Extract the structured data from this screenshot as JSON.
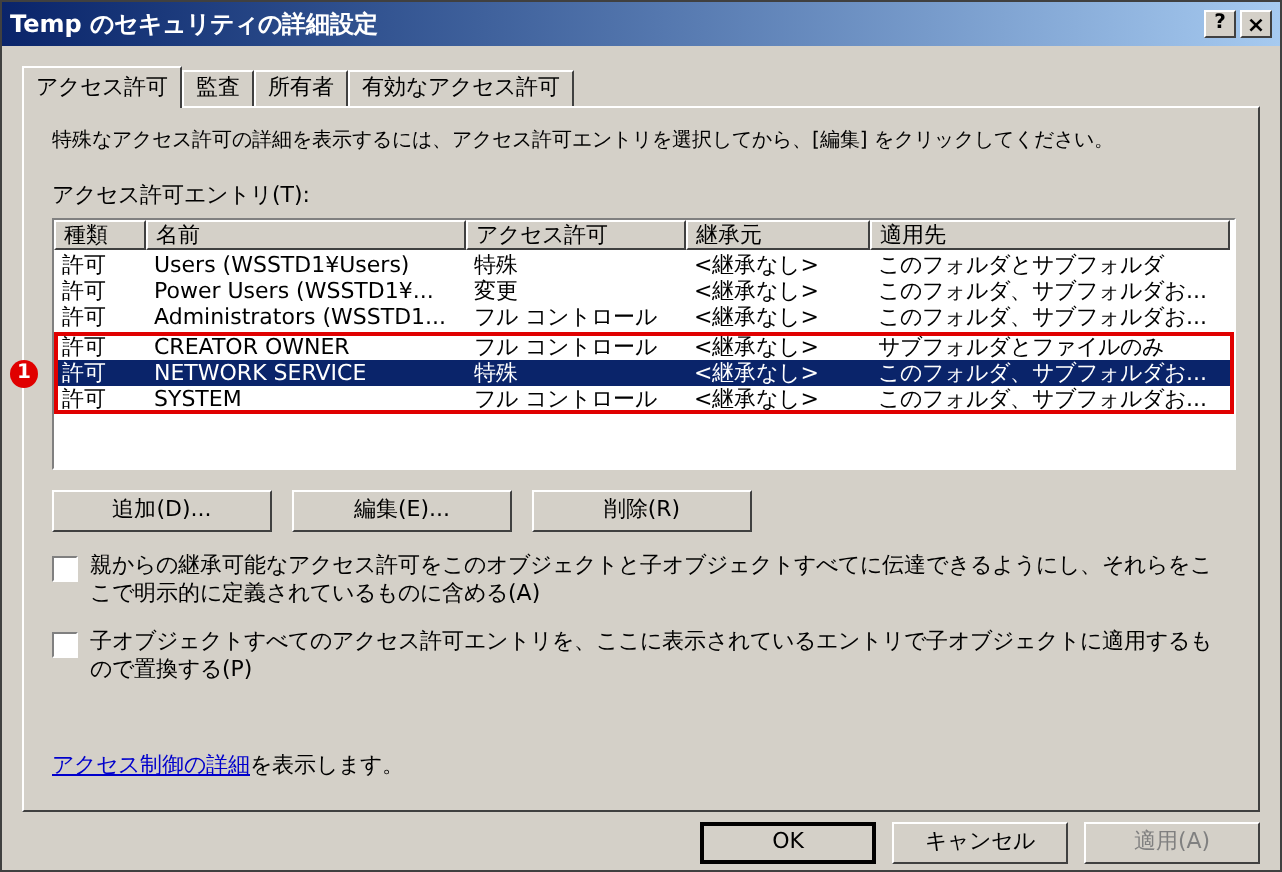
{
  "window": {
    "title": "Temp のセキュリティの詳細設定",
    "help_button": "?",
    "close_button": "×"
  },
  "tabs": [
    {
      "label": "アクセス許可",
      "selected": true
    },
    {
      "label": "監査",
      "selected": false
    },
    {
      "label": "所有者",
      "selected": false
    },
    {
      "label": "有効なアクセス許可",
      "selected": false
    }
  ],
  "description": "特殊なアクセス許可の詳細を表示するには、アクセス許可エントリを選択してから、[編集] をクリックしてください。",
  "table": {
    "label": "アクセス許可エントリ(T):",
    "columns": [
      "種類",
      "名前",
      "アクセス許可",
      "継承元",
      "適用先"
    ],
    "row_groups": [
      {
        "rows": [
          {
            "cells": [
              "許可",
              "Users (WSSTD1¥Users)",
              "特殊",
              "<継承なし>",
              "このフォルダとサブフォルダ"
            ],
            "selected": false
          },
          {
            "cells": [
              "許可",
              "Power Users (WSSTD1¥...",
              "変更",
              "<継承なし>",
              "このフォルダ、サブフォルダお..."
            ],
            "selected": false
          },
          {
            "cells": [
              "許可",
              "Administrators (WSSTD1...",
              "フル コントロール",
              "<継承なし>",
              "このフォルダ、サブフォルダお..."
            ],
            "selected": false
          }
        ]
      },
      {
        "annotation": "1",
        "rows": [
          {
            "cells": [
              "許可",
              "CREATOR OWNER",
              "フル コントロール",
              "<継承なし>",
              "サブフォルダとファイルのみ"
            ],
            "selected": false
          },
          {
            "cells": [
              "許可",
              "NETWORK SERVICE",
              "特殊",
              "<継承なし>",
              "このフォルダ、サブフォルダお..."
            ],
            "selected": true
          },
          {
            "cells": [
              "許可",
              "SYSTEM",
              "フル コントロール",
              "<継承なし>",
              "このフォルダ、サブフォルダお..."
            ],
            "selected": false
          }
        ]
      }
    ]
  },
  "entry_buttons": [
    {
      "label": "追加(D)...",
      "disabled": false
    },
    {
      "label": "編集(E)...",
      "disabled": false
    },
    {
      "label": "削除(R)",
      "disabled": false
    }
  ],
  "checkboxes": [
    {
      "label": "親からの継承可能なアクセス許可をこのオブジェクトと子オブジェクトすべてに伝達できるようにし、それらをここで明示的に定義されているものに含める(A)",
      "checked": false
    },
    {
      "label": "子オブジェクトすべてのアクセス許可エントリを、ここに表示されているエントリで子オブジェクトに適用するもので置換する(P)",
      "checked": false
    }
  ],
  "details_link": {
    "link": "アクセス制御の詳細",
    "text": "を表示します。"
  },
  "dialog_buttons": [
    {
      "label": "OK",
      "disabled": false,
      "default": true
    },
    {
      "label": "キャンセル",
      "disabled": false,
      "default": false
    },
    {
      "label": "適用(A)",
      "disabled": true,
      "default": false
    }
  ]
}
